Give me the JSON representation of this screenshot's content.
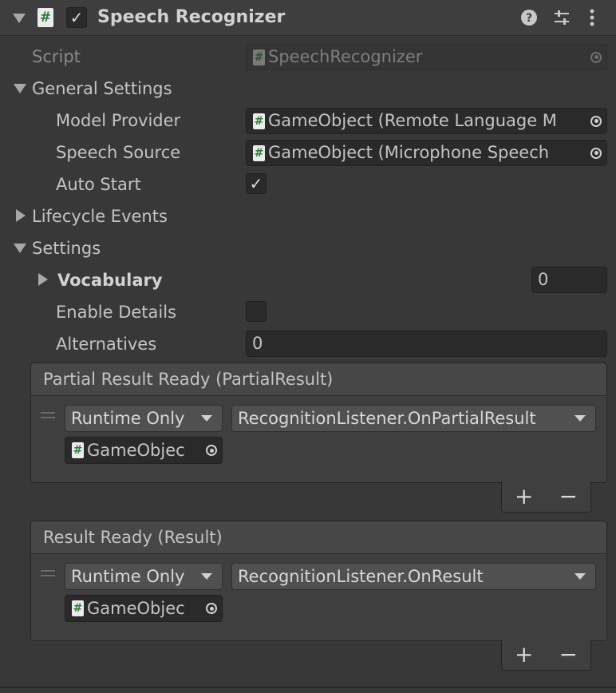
{
  "component": {
    "title": "Speech Recognizer",
    "script_icon": "#",
    "enabled_check": "✓",
    "header_icons": [
      "help-icon",
      "presets-icon",
      "more-menu-icon"
    ]
  },
  "script_row": {
    "label": "Script",
    "value": "SpeechRecognizer"
  },
  "general_settings": {
    "label": "General Settings",
    "model_provider": {
      "label": "Model Provider",
      "value": "GameObject (Remote Language M"
    },
    "speech_source": {
      "label": "Speech Source",
      "value": "GameObject (Microphone Speech"
    },
    "auto_start": {
      "label": "Auto Start",
      "check": "✓"
    }
  },
  "lifecycle_events": {
    "label": "Lifecycle Events"
  },
  "settings": {
    "label": "Settings",
    "vocabulary": {
      "label": "Vocabulary",
      "value": "0"
    },
    "enable_details": {
      "label": "Enable Details"
    },
    "alternatives": {
      "label": "Alternatives",
      "value": "0"
    }
  },
  "events": [
    {
      "title": "Partial Result Ready (PartialResult)",
      "mode": "Runtime Only",
      "function": "RecognitionListener.OnPartialResult",
      "target": "GameObjec",
      "add": "+",
      "remove": "−"
    },
    {
      "title": "Result Ready (Result)",
      "mode": "Runtime Only",
      "function": "RecognitionListener.OnResult",
      "target": "GameObjec",
      "add": "+",
      "remove": "−"
    }
  ],
  "colors": {
    "background": "#383838",
    "field": "#2a2a2a",
    "dropdown": "#505050",
    "text": "#c4c4c4",
    "script_icon_green": "#2e7d32"
  }
}
